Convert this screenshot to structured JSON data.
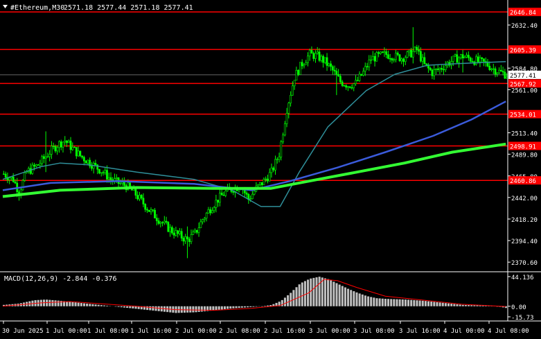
{
  "header": {
    "symbol": "#Ethereum,M30",
    "ohlc": "2571.18 2577.44 2571.18 2577.41"
  },
  "macd_panel": {
    "label": "MACD(12,26,9) -2.844 -0.376",
    "axis_ticks": [
      {
        "value": 44.136,
        "label": "44.136"
      },
      {
        "value": 0.0,
        "label": "0.00"
      },
      {
        "value": -15.73,
        "label": "-15.73"
      }
    ]
  },
  "colors": {
    "background": "#000000",
    "candle": "#00ff00",
    "level_line": "#ff0000",
    "ma_fast": "#2f8f9a",
    "ma_mid": "#3b5bdb",
    "ma_slow": "#33ff33",
    "macd_hist": "#c0c0c0",
    "macd_signal": "#ff0000",
    "text": "#ffffff"
  },
  "chart_data": {
    "type": "candlestick",
    "timeframe": "M30",
    "y_range": [
      2360,
      2660
    ],
    "y_ticks": [
      {
        "value": 2632.4,
        "label": "2632.40"
      },
      {
        "value": 2584.8,
        "label": "2584.80"
      },
      {
        "value": 2561.0,
        "label": "2561.00"
      },
      {
        "value": 2513.4,
        "label": "2513.40"
      },
      {
        "value": 2489.8,
        "label": "2489.80"
      },
      {
        "value": 2465.8,
        "label": "2465.80"
      },
      {
        "value": 2442.0,
        "label": "2442.00"
      },
      {
        "value": 2418.2,
        "label": "2418.20"
      },
      {
        "value": 2394.4,
        "label": "2394.40"
      },
      {
        "value": 2370.6,
        "label": "2370.60"
      }
    ],
    "levels": [
      {
        "value": 2646.84,
        "label": "2646.84"
      },
      {
        "value": 2605.39,
        "label": "2605.39"
      },
      {
        "value": 2567.92,
        "label": "2567.92"
      },
      {
        "value": 2534.01,
        "label": "2534.01"
      },
      {
        "value": 2498.91,
        "label": "2498.91"
      },
      {
        "value": 2460.86,
        "label": "2460.86"
      }
    ],
    "current_price": {
      "value": 2577.41,
      "label": "2577.41"
    },
    "x_labels": [
      "30 Jun 2025",
      "1 Jul 00:00",
      "1 Jul 08:00",
      "1 Jul 16:00",
      "2 Jul 00:00",
      "2 Jul 08:00",
      "2 Jul 16:00",
      "3 Jul 00:00",
      "3 Jul 08:00",
      "3 Jul 16:00",
      "4 Jul 00:00",
      "4 Jul 08:00"
    ],
    "close_path": [
      [
        0,
        2468
      ],
      [
        5,
        2462
      ],
      [
        8,
        2448
      ],
      [
        12,
        2470
      ],
      [
        18,
        2478
      ],
      [
        24,
        2492
      ],
      [
        28,
        2500
      ],
      [
        32,
        2505
      ],
      [
        36,
        2496
      ],
      [
        40,
        2488
      ],
      [
        44,
        2482
      ],
      [
        48,
        2476
      ],
      [
        52,
        2470
      ],
      [
        56,
        2462
      ],
      [
        60,
        2458
      ],
      [
        64,
        2455
      ],
      [
        68,
        2448
      ],
      [
        72,
        2438
      ],
      [
        76,
        2428
      ],
      [
        80,
        2420
      ],
      [
        84,
        2412
      ],
      [
        88,
        2405
      ],
      [
        92,
        2400
      ],
      [
        96,
        2395
      ],
      [
        100,
        2402
      ],
      [
        104,
        2418
      ],
      [
        108,
        2430
      ],
      [
        112,
        2440
      ],
      [
        116,
        2448
      ],
      [
        120,
        2452
      ],
      [
        124,
        2455
      ],
      [
        128,
        2440
      ],
      [
        132,
        2452
      ],
      [
        136,
        2460
      ],
      [
        140,
        2470
      ],
      [
        144,
        2490
      ],
      [
        148,
        2540
      ],
      [
        152,
        2575
      ],
      [
        156,
        2590
      ],
      [
        160,
        2600
      ],
      [
        164,
        2598
      ],
      [
        168,
        2592
      ],
      [
        172,
        2582
      ],
      [
        176,
        2570
      ],
      [
        180,
        2566
      ],
      [
        184,
        2568
      ],
      [
        188,
        2580
      ],
      [
        192,
        2595
      ],
      [
        196,
        2598
      ],
      [
        200,
        2600
      ],
      [
        204,
        2598
      ],
      [
        208,
        2596
      ],
      [
        212,
        2600
      ],
      [
        216,
        2605
      ],
      [
        220,
        2588
      ],
      [
        224,
        2580
      ],
      [
        228,
        2584
      ],
      [
        232,
        2590
      ],
      [
        236,
        2595
      ],
      [
        240,
        2598
      ],
      [
        244,
        2595
      ],
      [
        248,
        2592
      ],
      [
        252,
        2590
      ],
      [
        256,
        2584
      ],
      [
        260,
        2580
      ],
      [
        263,
        2577.41
      ]
    ],
    "spikes": [
      [
        22,
        2515,
        2470
      ],
      [
        96,
        2375,
        2410
      ],
      [
        174,
        2580,
        2555
      ],
      [
        214,
        2630,
        2590
      ],
      [
        240,
        2605,
        2580
      ]
    ],
    "moving_averages": [
      {
        "color": "#2f8f9a",
        "width": 1.5,
        "points": [
          [
            0,
            2462
          ],
          [
            20,
            2476
          ],
          [
            30,
            2480
          ],
          [
            45,
            2478
          ],
          [
            70,
            2470
          ],
          [
            100,
            2462
          ],
          [
            120,
            2450
          ],
          [
            135,
            2432
          ],
          [
            145,
            2432
          ],
          [
            155,
            2470
          ],
          [
            170,
            2520
          ],
          [
            190,
            2560
          ],
          [
            205,
            2578
          ],
          [
            222,
            2588
          ],
          [
            240,
            2590
          ],
          [
            263,
            2592
          ]
        ]
      },
      {
        "color": "#3b5bdb",
        "width": 2.5,
        "points": [
          [
            0,
            2450
          ],
          [
            25,
            2458
          ],
          [
            60,
            2460
          ],
          [
            100,
            2457
          ],
          [
            130,
            2450
          ],
          [
            150,
            2460
          ],
          [
            175,
            2475
          ],
          [
            200,
            2492
          ],
          [
            225,
            2510
          ],
          [
            245,
            2528
          ],
          [
            263,
            2548
          ]
        ]
      },
      {
        "color": "#33ff33",
        "width": 4,
        "points": [
          [
            0,
            2443
          ],
          [
            30,
            2450
          ],
          [
            70,
            2453
          ],
          [
            110,
            2452
          ],
          [
            140,
            2452
          ],
          [
            160,
            2460
          ],
          [
            185,
            2470
          ],
          [
            210,
            2480
          ],
          [
            235,
            2492
          ],
          [
            263,
            2501
          ]
        ]
      }
    ],
    "macd_hist": [
      [
        0,
        2
      ],
      [
        8,
        4
      ],
      [
        16,
        9
      ],
      [
        22,
        10
      ],
      [
        30,
        8
      ],
      [
        40,
        5
      ],
      [
        50,
        2
      ],
      [
        60,
        -1
      ],
      [
        70,
        -4
      ],
      [
        80,
        -7
      ],
      [
        90,
        -10
      ],
      [
        100,
        -9
      ],
      [
        110,
        -6
      ],
      [
        120,
        -3
      ],
      [
        135,
        0
      ],
      [
        140,
        2
      ],
      [
        145,
        8
      ],
      [
        150,
        20
      ],
      [
        155,
        34
      ],
      [
        160,
        41
      ],
      [
        165,
        44
      ],
      [
        170,
        40
      ],
      [
        175,
        33
      ],
      [
        180,
        26
      ],
      [
        185,
        20
      ],
      [
        190,
        15
      ],
      [
        195,
        12
      ],
      [
        200,
        11
      ],
      [
        210,
        10
      ],
      [
        220,
        8
      ],
      [
        230,
        5
      ],
      [
        240,
        2
      ],
      [
        250,
        1
      ],
      [
        258,
        0
      ],
      [
        263,
        -2.844
      ]
    ],
    "macd_signal": [
      [
        0,
        0
      ],
      [
        20,
        5
      ],
      [
        35,
        7
      ],
      [
        50,
        4
      ],
      [
        70,
        0
      ],
      [
        90,
        -5
      ],
      [
        110,
        -6
      ],
      [
        130,
        -3
      ],
      [
        145,
        1
      ],
      [
        160,
        20
      ],
      [
        168,
        40
      ],
      [
        175,
        38
      ],
      [
        185,
        28
      ],
      [
        200,
        15
      ],
      [
        220,
        9
      ],
      [
        240,
        3
      ],
      [
        263,
        -0.376
      ]
    ]
  }
}
